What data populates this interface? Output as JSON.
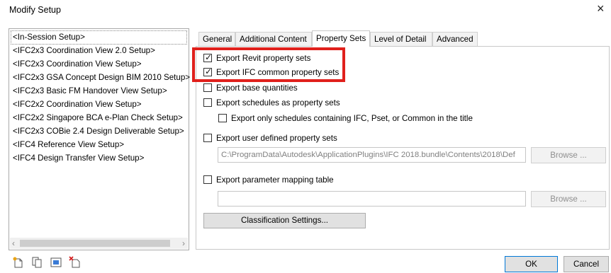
{
  "window": {
    "title": "Modify Setup",
    "close_glyph": "×"
  },
  "setups": {
    "items": [
      "<In-Session Setup>",
      "<IFC2x3 Coordination View 2.0 Setup>",
      "<IFC2x3 Coordination View Setup>",
      "<IFC2x3 GSA Concept Design BIM 2010 Setup>",
      "<IFC2x3 Basic FM Handover View Setup>",
      "<IFC2x2 Coordination View Setup>",
      "<IFC2x2 Singapore BCA e-Plan Check Setup>",
      "<IFC2x3 COBie 2.4 Design Deliverable Setup>",
      "<IFC4 Reference View Setup>",
      "<IFC4 Design Transfer View Setup>"
    ],
    "selected_index": 0
  },
  "tabs": [
    "General",
    "Additional Content",
    "Property Sets",
    "Level of Detail",
    "Advanced"
  ],
  "active_tab": "Property Sets",
  "options": {
    "export_revit_psets": {
      "label": "Export Revit property sets",
      "checked": true
    },
    "export_ifc_common_psets": {
      "label": "Export IFC common property sets",
      "checked": true
    },
    "export_base_quantities": {
      "label": "Export base quantities",
      "checked": false
    },
    "export_schedules": {
      "label": "Export schedules as property sets",
      "checked": false
    },
    "export_only_schedules_ifc": {
      "label": "Export only schedules containing IFC, Pset, or Common in the title",
      "checked": false
    },
    "export_user_defined": {
      "label": "Export user defined property sets",
      "checked": false
    },
    "export_param_mapping": {
      "label": "Export parameter mapping table",
      "checked": false
    }
  },
  "user_defined_path": "C:\\ProgramData\\Autodesk\\ApplicationPlugins\\IFC 2018.bundle\\Contents\\2018\\Def",
  "buttons": {
    "browse": "Browse ...",
    "classification": "Classification Settings...",
    "ok": "OK",
    "cancel": "Cancel"
  },
  "toolbar_icons": [
    "new-setup-icon",
    "duplicate-setup-icon",
    "rename-setup-icon",
    "delete-setup-icon"
  ],
  "colors": {
    "highlight": "#e0201c"
  }
}
